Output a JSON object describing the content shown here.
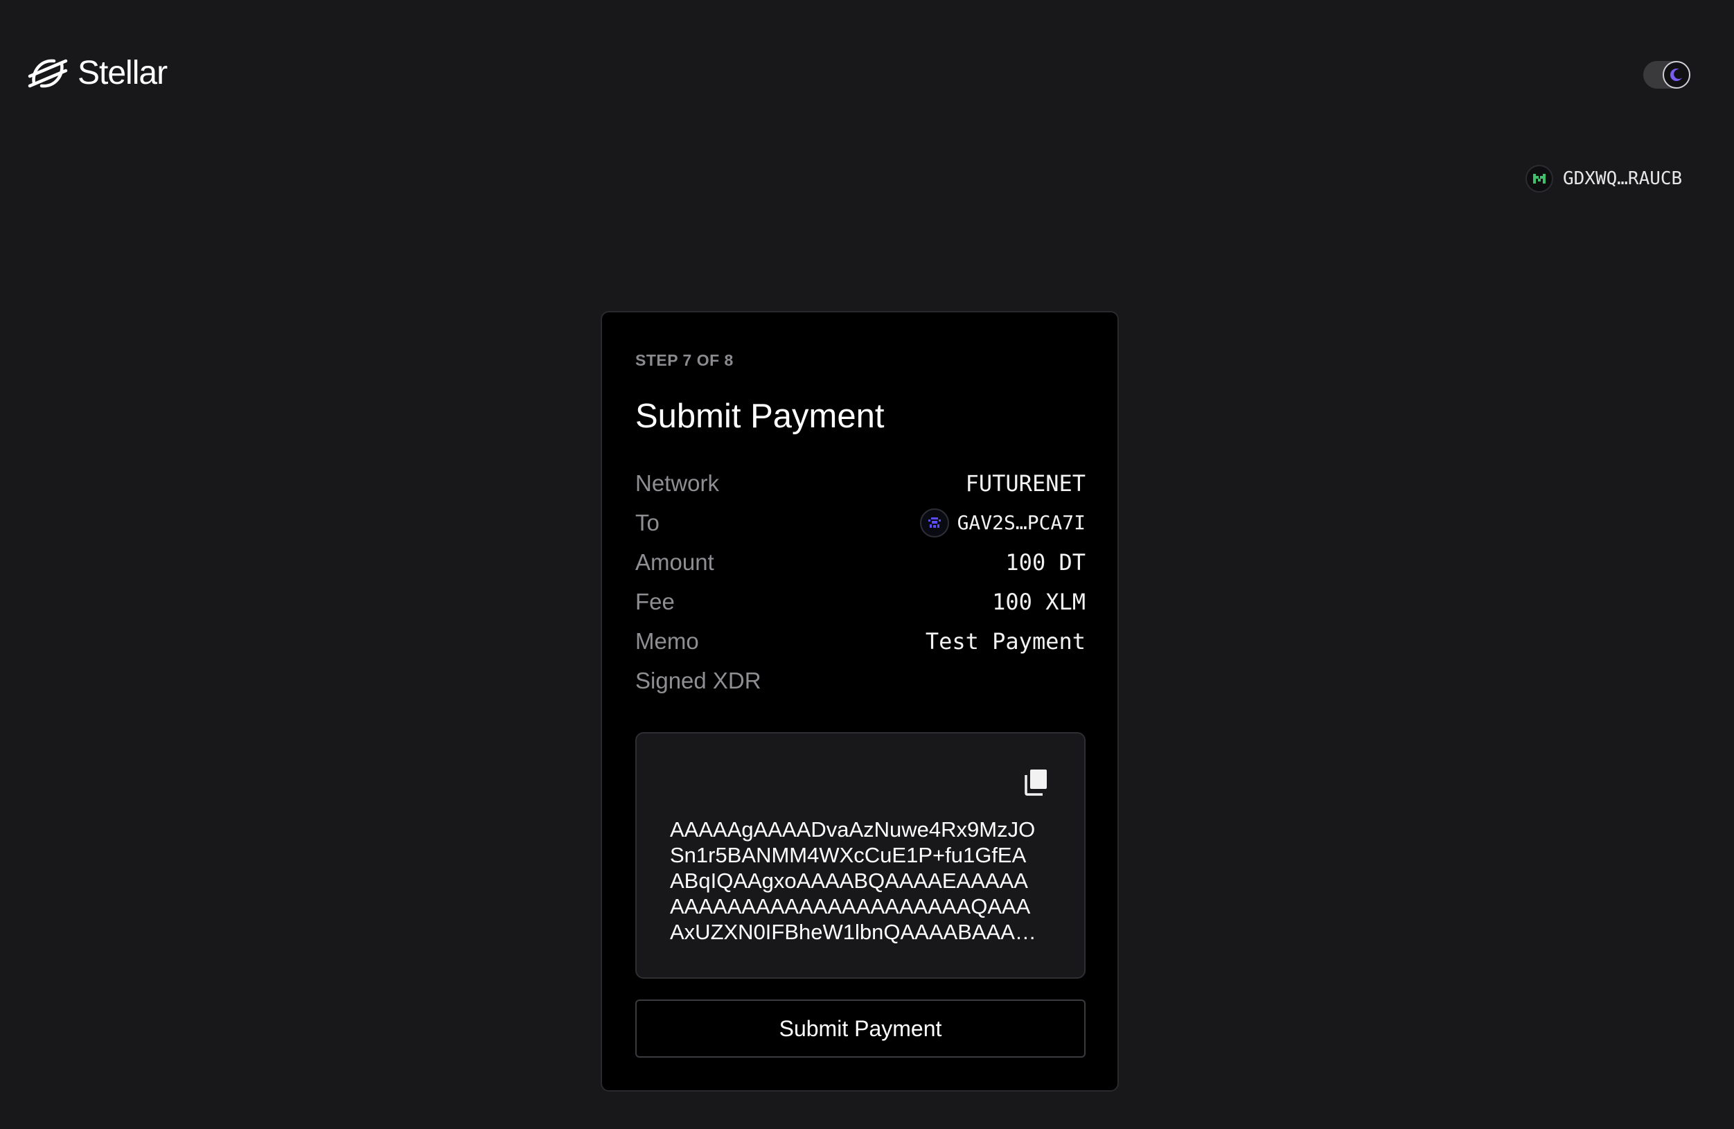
{
  "header": {
    "brand": "Stellar",
    "account_address": "GDXWQ…RAUCB"
  },
  "card": {
    "step_label": "STEP 7 OF 8",
    "title": "Submit Payment",
    "details": [
      {
        "label": "Network",
        "value": "FUTURENET"
      },
      {
        "label": "To",
        "value": "GAV2S…PCA7I"
      },
      {
        "label": "Amount",
        "value": "100 DT"
      },
      {
        "label": "Fee",
        "value": "100 XLM"
      },
      {
        "label": "Memo",
        "value": "Test Payment"
      },
      {
        "label": "Signed XDR",
        "value": ""
      }
    ],
    "signed_xdr_lines": "AAAAAgAAAADvaAzNuwe4Rx9MzJO\nSn1r5BANMM4WXcCuE1P+fu1GfEA\nABqIQAAgxoAAAABQAAAAEAAAAA\nAAAAAAAAAAAAAAAAAAAAAQAAA\nAxUZXN0IFBheW1lbnQAAAABAAA…",
    "submit_label": "Submit Payment"
  },
  "colors": {
    "background": "#18181a",
    "card_background": "#000000",
    "toggle_accent": "#7b5cf0",
    "account_identicon": "#3fbf6a",
    "recipient_identicon": "#5b4cf5"
  },
  "icons": {
    "logo": "stellar-logo-icon",
    "theme": "moon-icon",
    "copy": "copy-icon"
  }
}
